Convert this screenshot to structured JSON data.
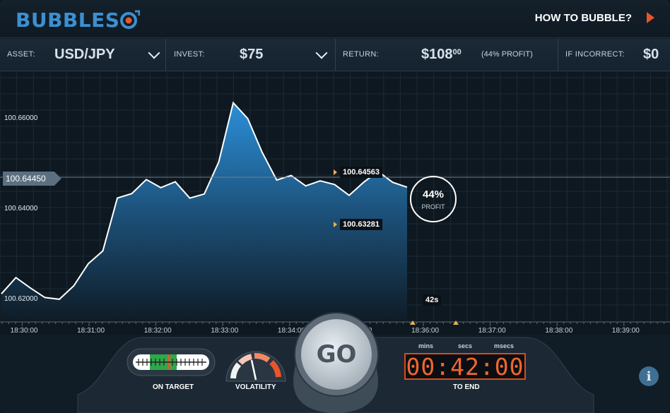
{
  "header": {
    "logo_text": "BUBBLES",
    "how_to_label": "HOW TO BUBBLE?",
    "brand_color": "#3d8fd0",
    "accent_color": "#e8552a"
  },
  "options": {
    "asset_label": "ASSET:",
    "asset_value": "USD/JPY",
    "invest_label": "INVEST:",
    "invest_value": "$75",
    "return_label": "RETURN:",
    "return_value": "$108",
    "return_cents": "00",
    "return_note": "(44% PROFIT)",
    "incorrect_label": "IF INCORRECT:",
    "incorrect_value": "$0"
  },
  "chart": {
    "current_price": "100.64450",
    "upper_price": "100.64563",
    "lower_price": "100.63281",
    "bubble_percent": "44%",
    "bubble_label": "PROFIT",
    "countdown_badge": "42s"
  },
  "chart_data": {
    "type": "area",
    "title": "",
    "xlabel": "",
    "ylabel": "",
    "y_ticks": [
      "100.66000",
      "100.64000",
      "100.62000"
    ],
    "x_ticks": [
      "18:30:00",
      "18:31:00",
      "18:32:00",
      "18:33:00",
      "18:34:00",
      "18:35:00",
      "18:36:00",
      "18:37:00",
      "18:38:00",
      "18:39:00"
    ],
    "ylim": [
      100.615,
      100.67
    ],
    "series": [
      {
        "values": [
          100.6209,
          100.6245,
          100.6222,
          100.6201,
          100.6197,
          100.6227,
          100.6276,
          100.6304,
          100.6421,
          100.6431,
          100.6462,
          100.6444,
          100.6457,
          100.6421,
          100.643,
          100.6501,
          100.6632,
          100.6597,
          100.6522,
          100.6461,
          100.6471,
          100.6448,
          100.6459,
          100.6451,
          100.6427,
          100.6456,
          100.648,
          100.6456,
          100.6445
        ]
      }
    ],
    "bubble_window": {
      "upper": 100.64563,
      "lower": 100.63281
    }
  },
  "controls": {
    "on_target_label": "ON TARGET",
    "volatility_label": "VOLATILITY",
    "go_label": "GO",
    "timer_value": "00:42:00",
    "timer_mins_label": "mins",
    "timer_secs_label": "secs",
    "timer_msecs_label": "msecs",
    "to_end_label": "TO END",
    "info_symbol": "i"
  }
}
